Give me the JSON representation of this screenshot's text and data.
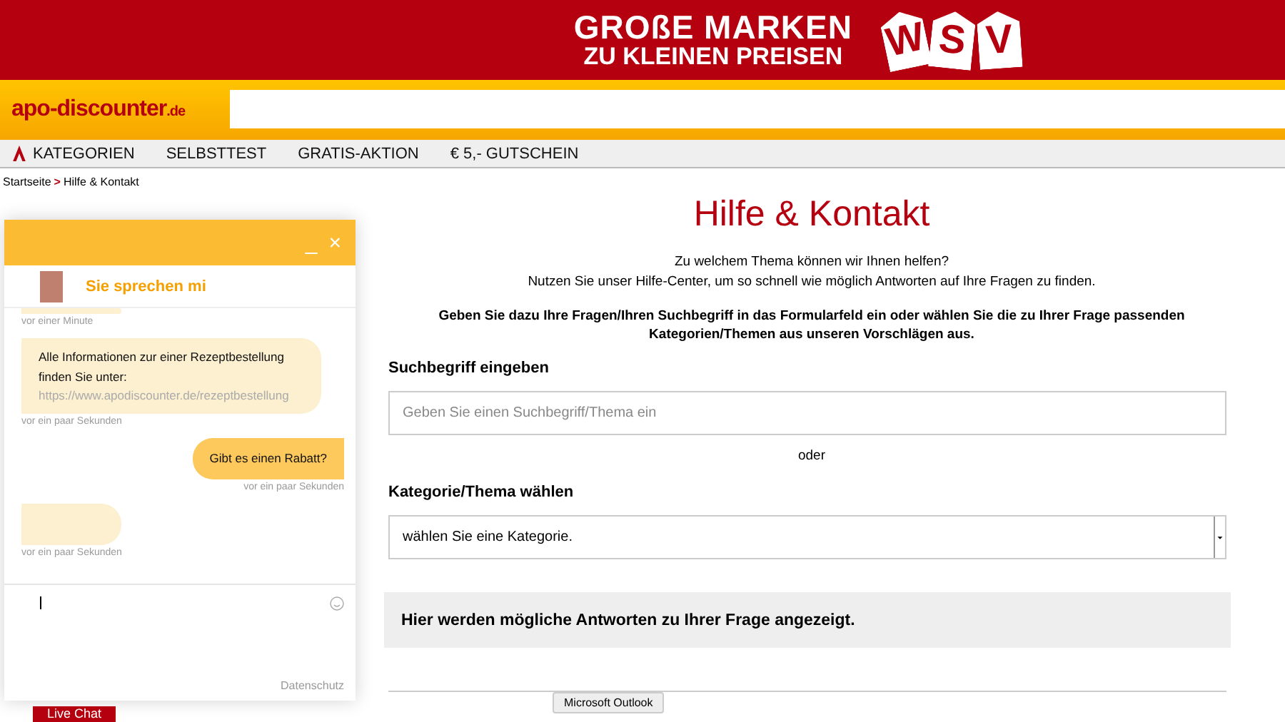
{
  "banner": {
    "line_1": "GROßE MARKEN",
    "line_2": "ZU KLEINEN PREISEN",
    "tags": [
      "W",
      "S",
      "V"
    ]
  },
  "header": {
    "logo": "apo-discounter",
    "logo_suffix": ".de"
  },
  "nav": [
    "KATEGORIEN",
    "SELBSTTEST",
    "GRATIS-AKTION",
    "€ 5,- GUTSCHEIN"
  ],
  "breadcrumb": {
    "home": "Startseite",
    "separator": ">",
    "current": "Hilfe & Kontakt"
  },
  "chat": {
    "minimize": "_",
    "close": "×",
    "agent_label": "Sie sprechen mi",
    "privacy": "Datenschutz",
    "messages": [
      {
        "kind": "agent_cut",
        "time": "vor einer Minute"
      },
      {
        "kind": "agent",
        "text": "Alle Informationen zur einer Rezeptbestellung finden Sie unter:",
        "link": "https://www.apodiscounter.de/rezeptbestellung",
        "time": "vor ein paar Sekunden"
      },
      {
        "kind": "user",
        "text": "Gibt es einen Rabatt?",
        "time": "vor ein paar Sekunden"
      },
      {
        "kind": "typing",
        "time": "vor ein paar Sekunden"
      }
    ],
    "launcher": "Live Chat"
  },
  "main": {
    "title": "Hilfe & Kontakt",
    "intro_1": "Zu welchem Thema können wir Ihnen helfen?",
    "intro_2": "Nutzen Sie unser Hilfe-Center, um so schnell wie möglich Antworten auf Ihre Fragen zu finden.",
    "instruction": "Geben Sie dazu Ihre Fragen/Ihren Suchbegriff in das Formularfeld ein oder wählen Sie die zu Ihrer Frage passenden Kategorien/Themen aus unseren Vorschlägen aus.",
    "search_label": "Suchbegriff eingeben",
    "search_placeholder": "Geben Sie einen Suchbegriff/Thema ein",
    "or": "oder",
    "category_label": "Kategorie/Thema wählen",
    "category_value": "wählen Sie eine Kategorie.",
    "answers": "Hier werden mögliche Antworten zu Ihrer Frage angezeigt.",
    "tooltip": "Microsoft Outlook"
  }
}
